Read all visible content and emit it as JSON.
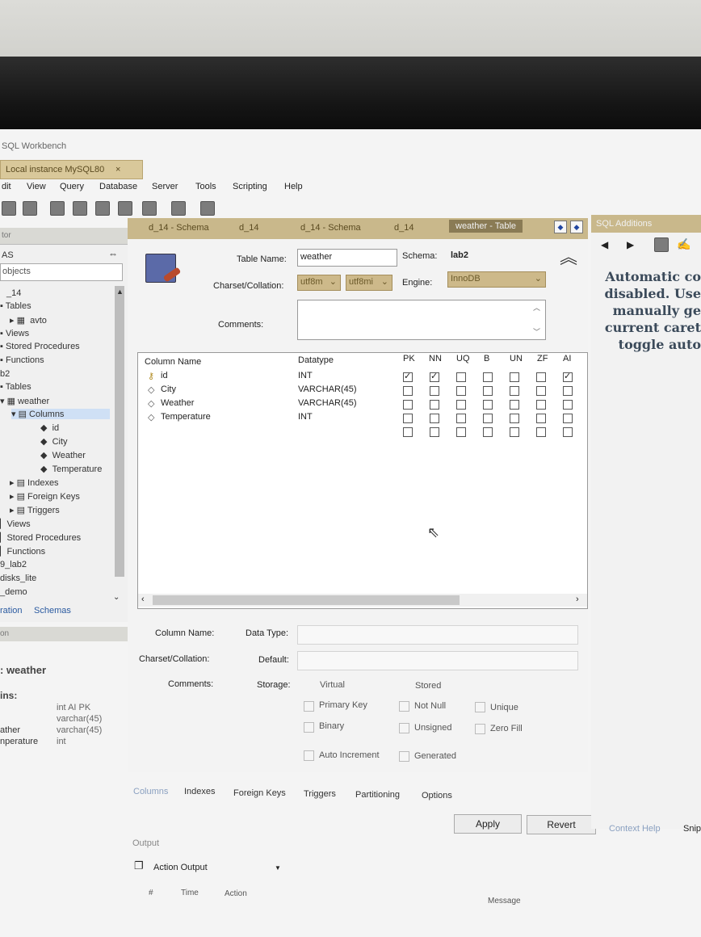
{
  "app": {
    "title": "SQL Workbench",
    "connection_tab": "Local instance MySQL80",
    "connection_tab_close": "×"
  },
  "menu": [
    "dit",
    "View",
    "Query",
    "Database",
    "Server",
    "Tools",
    "Scripting",
    "Help"
  ],
  "sidebar": {
    "header": "tor",
    "section_label": "AS",
    "search_placeholder": "objects",
    "tree": [
      {
        "label": "_14",
        "indent": 0
      },
      {
        "label": "Tables",
        "indent": 1
      },
      {
        "label": "avto",
        "indent": 2
      },
      {
        "label": "Views",
        "indent": 1
      },
      {
        "label": "Stored Procedures",
        "indent": 1
      },
      {
        "label": "Functions",
        "indent": 1
      },
      {
        "label": "b2",
        "indent": 0
      },
      {
        "label": "Tables",
        "indent": 1
      },
      {
        "label": "weather",
        "indent": 2
      },
      {
        "label": "Columns",
        "indent": 3
      },
      {
        "label": "id",
        "indent": 4
      },
      {
        "label": "City",
        "indent": 4
      },
      {
        "label": "Weather",
        "indent": 4
      },
      {
        "label": "Temperature",
        "indent": 4
      },
      {
        "label": "Indexes",
        "indent": 3
      },
      {
        "label": "Foreign Keys",
        "indent": 3
      },
      {
        "label": "Triggers",
        "indent": 3
      },
      {
        "label": "Views",
        "indent": 1
      },
      {
        "label": "Stored Procedures",
        "indent": 1
      },
      {
        "label": "Functions",
        "indent": 1
      },
      {
        "label": "9_lab2",
        "indent": 0
      },
      {
        "label": "disks_lite",
        "indent": 0
      },
      {
        "label": "_demo",
        "indent": 0
      }
    ],
    "tabs": [
      "ration",
      "Schemas"
    ],
    "info_header": "on",
    "info_title": ": weather",
    "info_columns_label": "ins:",
    "info_rows": [
      {
        "name": "",
        "type": "int AI PK"
      },
      {
        "name": "",
        "type": "varchar(45)"
      },
      {
        "name": "ather",
        "type": "varchar(45)"
      },
      {
        "name": "nperature",
        "type": "int"
      }
    ]
  },
  "editor_tabs": [
    {
      "label": "d_14 - Schema",
      "active": false
    },
    {
      "label": "d_14",
      "active": false
    },
    {
      "label": "d_14 - Schema",
      "active": false
    },
    {
      "label": "d_14",
      "active": false
    },
    {
      "label": "weather - Table",
      "active": true
    }
  ],
  "form": {
    "table_name_label": "Table Name:",
    "table_name_value": "weather",
    "schema_label": "Schema:",
    "schema_value": "lab2",
    "charset_label": "Charset/Collation:",
    "charset_value": "utf8m",
    "collation_value": "utf8mi",
    "engine_label": "Engine:",
    "engine_value": "InnoDB",
    "comments_label": "Comments:"
  },
  "grid": {
    "headers": [
      "Column Name",
      "Datatype",
      "PK",
      "NN",
      "UQ",
      "B",
      "UN",
      "ZF",
      "AI"
    ],
    "rows": [
      {
        "name": "id",
        "type": "INT",
        "flags": [
          true,
          true,
          false,
          false,
          false,
          false,
          true
        ]
      },
      {
        "name": "City",
        "type": "VARCHAR(45)",
        "flags": [
          false,
          false,
          false,
          false,
          false,
          false,
          false
        ]
      },
      {
        "name": "Weather",
        "type": "VARCHAR(45)",
        "flags": [
          false,
          false,
          false,
          false,
          false,
          false,
          false
        ]
      },
      {
        "name": "Temperature",
        "type": "INT",
        "flags": [
          false,
          false,
          false,
          false,
          false,
          false,
          false
        ]
      }
    ]
  },
  "details": {
    "column_name_label": "Column Name:",
    "data_type_label": "Data Type:",
    "charset_label": "Charset/Collation:",
    "default_label": "Default:",
    "comments_label": "Comments:",
    "storage_label": "Storage:",
    "virtual": "Virtual",
    "stored": "Stored",
    "primary_key": "Primary Key",
    "not_null": "Not Null",
    "unique": "Unique",
    "binary": "Binary",
    "unsigned": "Unsigned",
    "zero_fill": "Zero Fill",
    "auto_increment": "Auto Increment",
    "generated": "Generated"
  },
  "bottom_tabs": [
    "Columns",
    "Indexes",
    "Foreign Keys",
    "Triggers",
    "Partitioning",
    "Options"
  ],
  "buttons": {
    "apply": "Apply",
    "revert": "Revert"
  },
  "right_panel": {
    "header": "SQL Additions",
    "text_lines": [
      "Automatic co",
      "disabled. Use",
      "manually ge",
      "current caret",
      "toggle auto"
    ],
    "bottom_tabs": [
      "Context Help",
      "Snip"
    ]
  },
  "output": {
    "label": "Output",
    "dropdown": "Action Output",
    "columns": [
      "#",
      "Time",
      "Action",
      "Message"
    ]
  }
}
